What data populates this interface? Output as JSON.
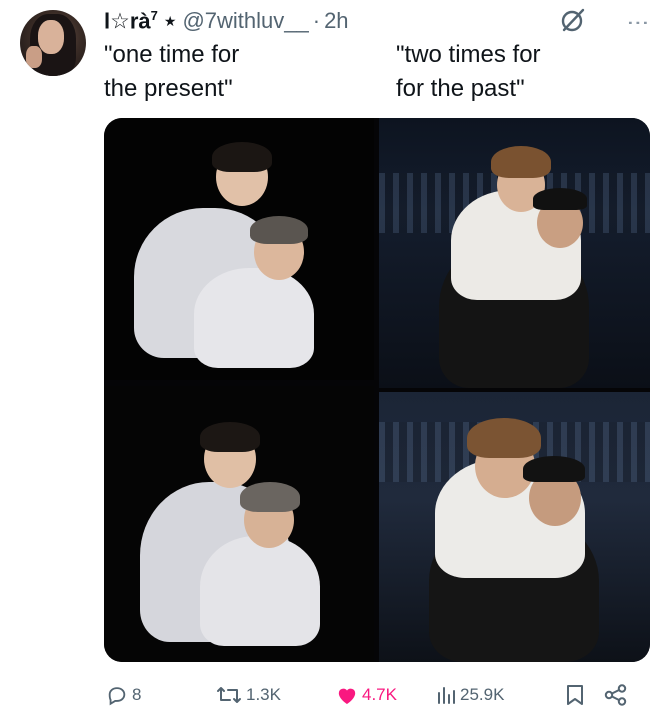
{
  "post": {
    "display_name": "l☆rà",
    "display_name_sup": "7",
    "star": "★",
    "handle": "@7withluv__",
    "dot": "·",
    "time": "2h",
    "more_glyph": "⋮",
    "caption_left": "\"one time for\nthe present\"",
    "caption_right": "\"two times for\nfor the past\""
  },
  "icons": {
    "grok": "grok-icon",
    "more": "more-icon",
    "reply": "reply-icon",
    "repost": "repost-icon",
    "like": "heart-icon",
    "views": "views-icon",
    "bookmark": "bookmark-icon",
    "share": "share-icon"
  },
  "actions": {
    "replies": "8",
    "reposts": "1.3K",
    "likes": "4.7K",
    "views": "25.9K"
  },
  "colors": {
    "text": "#0f1419",
    "secondary": "#536471",
    "like": "#f91880"
  }
}
